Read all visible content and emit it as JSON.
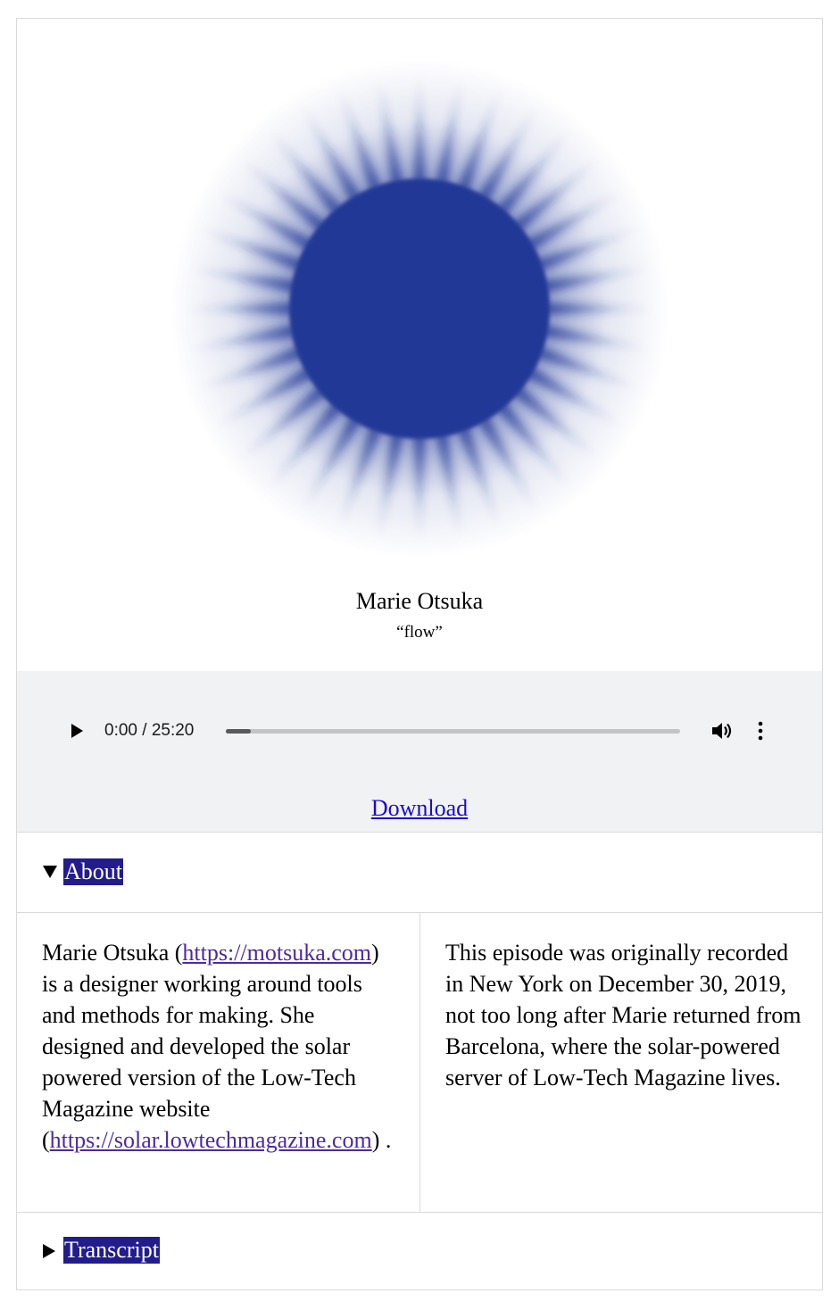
{
  "episode": {
    "guest_name": "Marie Otsuka",
    "title": "“flow”",
    "artwork_icon": "radiant-sun-icon",
    "artwork_color": "#213796"
  },
  "player": {
    "time_display": "0:00 / 25:20",
    "progress": 0.055,
    "play_icon": "play-icon",
    "volume_icon": "volume-icon",
    "menu_icon": "more-vertical-icon",
    "download_label": "Download"
  },
  "about": {
    "label": "About",
    "expanded": true,
    "left_text_1": "Marie Otsuka (",
    "left_link_1": "https://motsuka.com",
    "left_text_2": ") is a designer working around tools and methods for making. She designed and developed the solar powered version of the Low-Tech Magazine website (",
    "left_link_2": "https://solar.lowtechmagazine.com",
    "left_text_3": ") .",
    "right_text": "This episode was originally recorded in New York on December 30, 2019, not too long after Marie returned from Barcelona, where the solar-powered server of Low-Tech Magazine lives."
  },
  "transcript": {
    "label": "Transcript",
    "expanded": false
  },
  "colors": {
    "summary_highlight": "#231c8c",
    "link": "#1a0dcc",
    "visited_link": "#4e2aa0",
    "player_bg": "#f1f2f4",
    "border": "#d9d9d9"
  }
}
